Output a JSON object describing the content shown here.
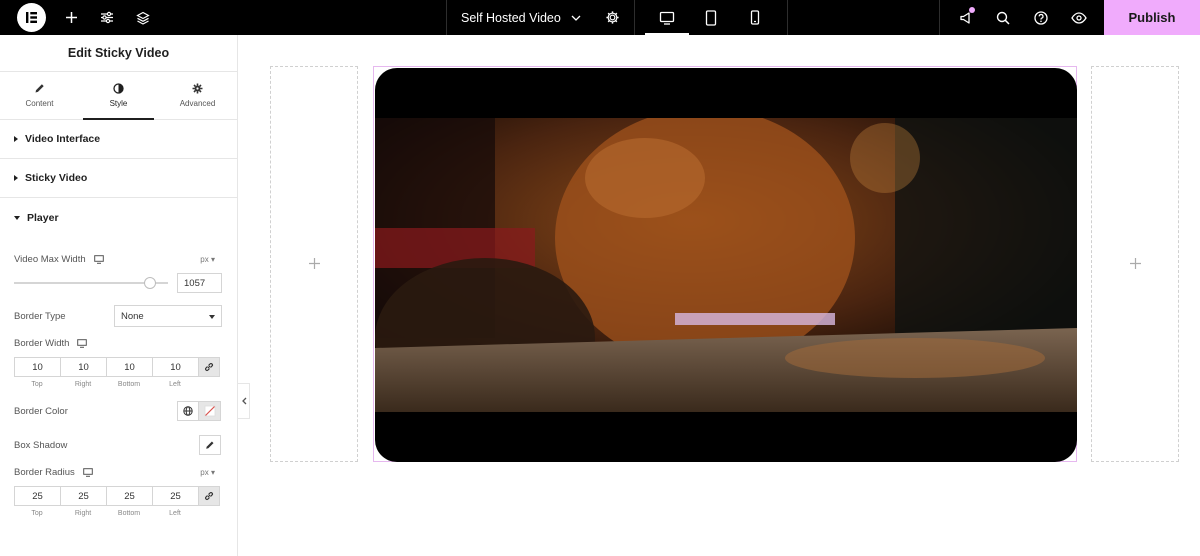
{
  "topbar": {
    "document_title": "Self Hosted Video",
    "publish_label": "Publish",
    "devices": [
      "desktop",
      "tablet",
      "mobile"
    ],
    "active_device": "desktop",
    "accent_color": "#f0abfc"
  },
  "panel": {
    "title": "Edit Sticky Video",
    "tabs": [
      {
        "label": "Content",
        "icon": "pencil-icon"
      },
      {
        "label": "Style",
        "icon": "half-circle-icon",
        "active": true
      },
      {
        "label": "Advanced",
        "icon": "gear-icon"
      }
    ],
    "sections": {
      "video_interface": "Video Interface",
      "sticky_video": "Sticky Video",
      "player": "Player"
    },
    "controls": {
      "video_max_width": {
        "label": "Video Max Width",
        "unit": "px",
        "value": "1057",
        "slider_fraction": 0.88
      },
      "border_type": {
        "label": "Border Type",
        "value": "None"
      },
      "border_width": {
        "label": "Border Width",
        "values": [
          "10",
          "10",
          "10",
          "10"
        ]
      },
      "border_color": {
        "label": "Border Color"
      },
      "box_shadow": {
        "label": "Box Shadow"
      },
      "border_radius": {
        "label": "Border Radius",
        "unit": "px",
        "values": [
          "25",
          "25",
          "25",
          "25"
        ]
      },
      "sides": [
        "Top",
        "Right",
        "Bottom",
        "Left"
      ]
    }
  }
}
